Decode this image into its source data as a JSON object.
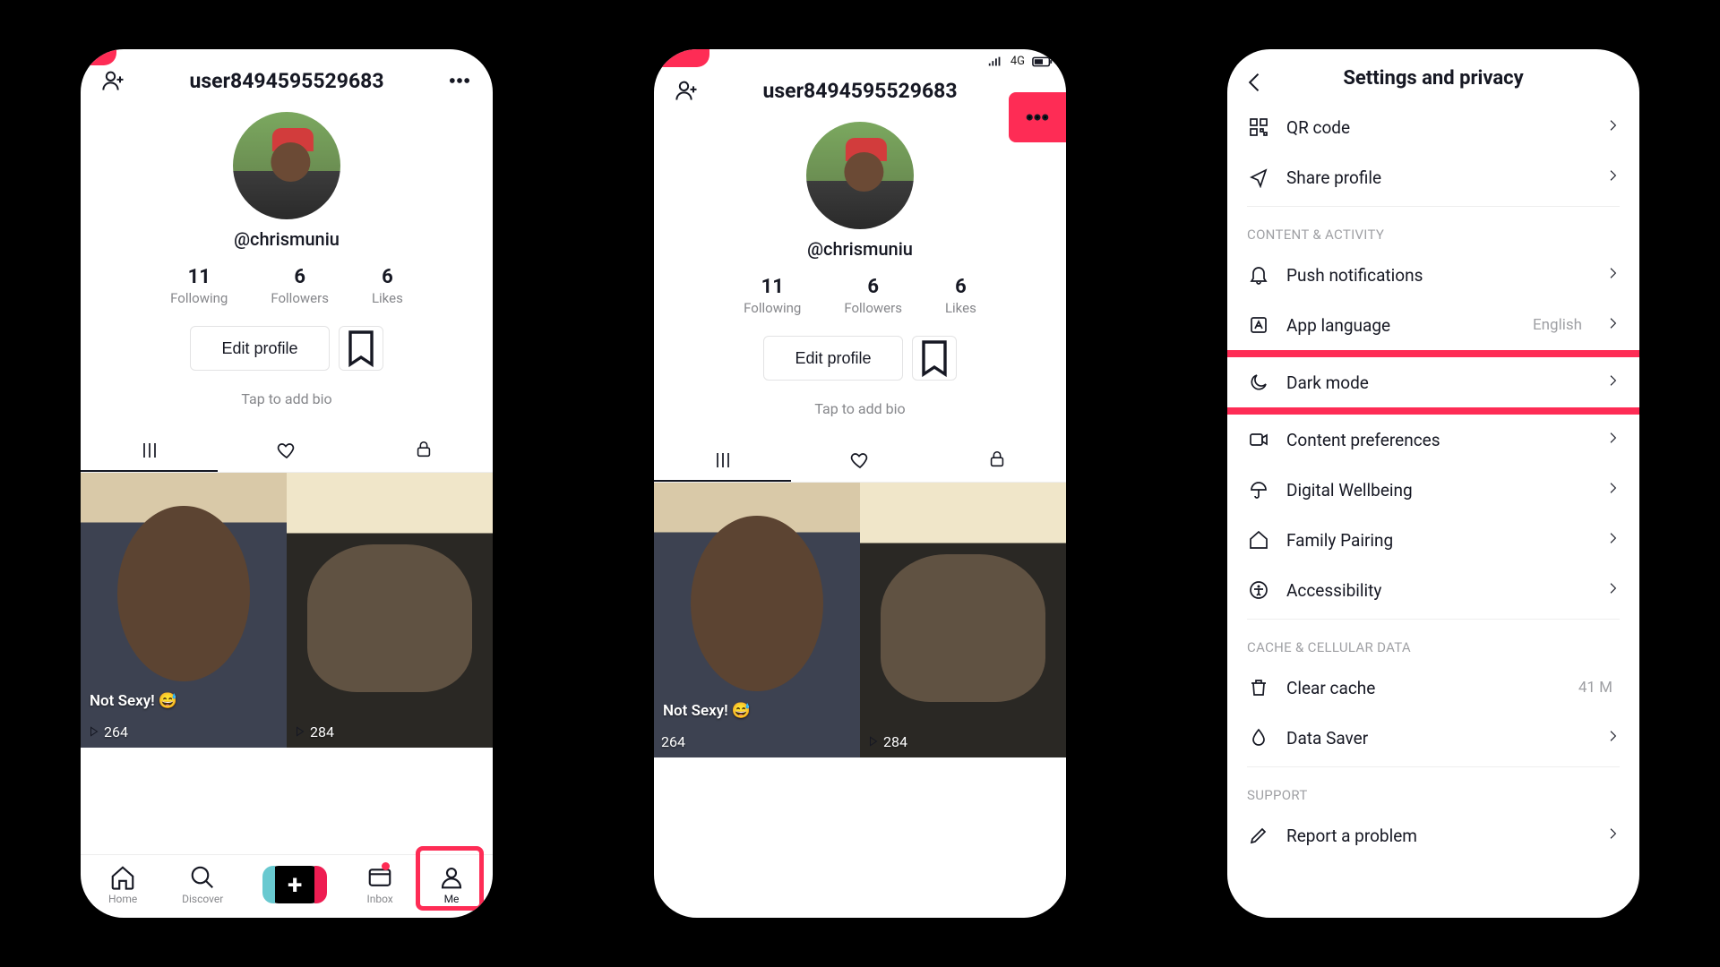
{
  "phone1": {
    "username": "user8494595529683",
    "handle": "@chrismuniu",
    "stats": {
      "following": {
        "num": "11",
        "lbl": "Following"
      },
      "followers": {
        "num": "6",
        "lbl": "Followers"
      },
      "likes": {
        "num": "6",
        "lbl": "Likes"
      }
    },
    "editProfile": "Edit profile",
    "bio": "Tap to add bio",
    "videos": [
      {
        "caption": "Not Sexy! 😅",
        "views": "264"
      },
      {
        "caption": "",
        "views": "284"
      }
    ],
    "nav": {
      "home": "Home",
      "discover": "Discover",
      "inbox": "Inbox",
      "me": "Me"
    }
  },
  "phone2": {
    "statusNetwork": "4G",
    "username": "user8494595529683",
    "handle": "@chrismuniu",
    "stats": {
      "following": {
        "num": "11",
        "lbl": "Following"
      },
      "followers": {
        "num": "6",
        "lbl": "Followers"
      },
      "likes": {
        "num": "6",
        "lbl": "Likes"
      }
    },
    "editProfile": "Edit profile",
    "bio": "Tap to add bio",
    "videos": [
      {
        "caption": "Not Sexy! 😅",
        "views": "264"
      },
      {
        "caption": "",
        "views": "284"
      }
    ]
  },
  "phone3": {
    "title": "Settings and privacy",
    "rows": {
      "qr": "QR code",
      "share": "Share profile",
      "section1": "CONTENT & ACTIVITY",
      "push": "Push notifications",
      "lang": "App language",
      "langValue": "English",
      "dark": "Dark mode",
      "content": "Content preferences",
      "wellbeing": "Digital Wellbeing",
      "family": "Family Pairing",
      "access": "Accessibility",
      "section2": "CACHE & CELLULAR DATA",
      "cache": "Clear cache",
      "cacheValue": "41 M",
      "saver": "Data Saver",
      "section3": "SUPPORT",
      "report": "Report a problem"
    }
  }
}
